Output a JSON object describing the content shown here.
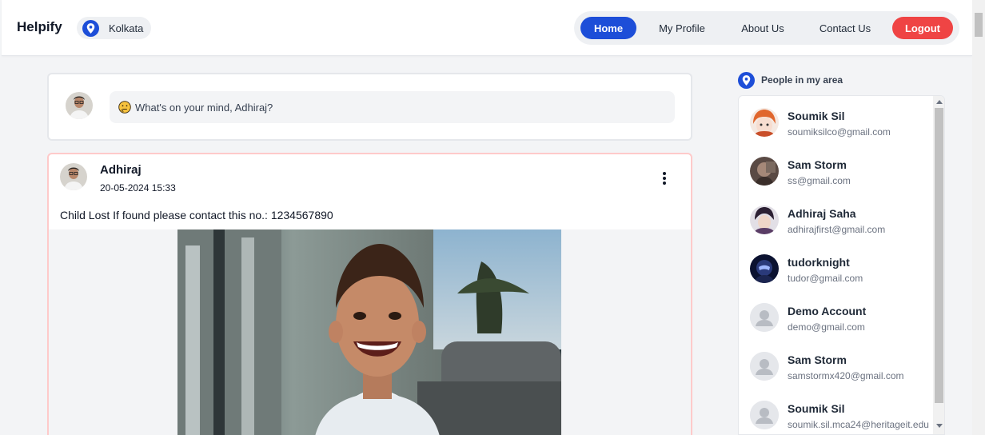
{
  "header": {
    "brand": "Helpify",
    "location": "Kolkata",
    "nav": {
      "home": "Home",
      "profile": "My Profile",
      "about": "About Us",
      "contact": "Contact Us",
      "logout": "Logout"
    }
  },
  "composer": {
    "placeholder": "What's on your mind, Adhiraj?"
  },
  "post": {
    "author": "Adhiraj",
    "timestamp": "20-05-2024 15:33",
    "text": "Child Lost If found please contact this no.: 1234567890"
  },
  "people": {
    "title": "People in my area",
    "items": [
      {
        "name": "Soumik Sil",
        "email": "soumiksilco@gmail.com"
      },
      {
        "name": "Sam Storm",
        "email": "ss@gmail.com"
      },
      {
        "name": "Adhiraj Saha",
        "email": "adhirajfirst@gmail.com"
      },
      {
        "name": "tudorknight",
        "email": "tudor@gmail.com"
      },
      {
        "name": "Demo Account",
        "email": "demo@gmail.com"
      },
      {
        "name": "Sam Storm",
        "email": "samstormx420@gmail.com"
      },
      {
        "name": "Soumik Sil",
        "email": "soumik.sil.mca24@heritageit.edu"
      }
    ]
  },
  "colors": {
    "primary": "#1d4ed8",
    "danger": "#ef4444",
    "post_border": "#fecaca"
  }
}
